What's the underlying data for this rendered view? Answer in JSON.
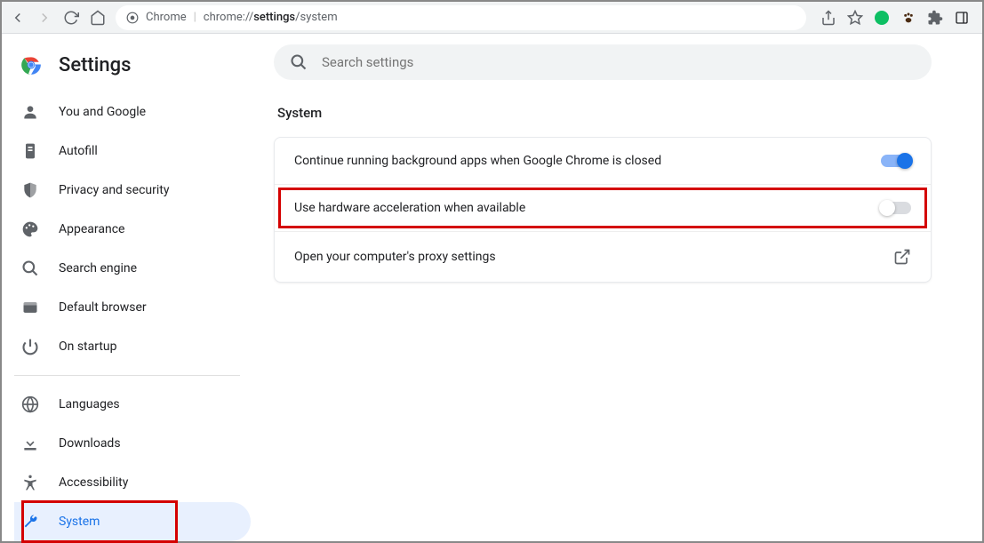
{
  "toolbar": {
    "url_prefix": "Chrome",
    "url_host": "chrome://",
    "url_path_bold": "settings",
    "url_path_rest": "/system"
  },
  "app": {
    "title": "Settings"
  },
  "sidebar": {
    "group1": [
      {
        "label": "You and Google",
        "icon": "person"
      },
      {
        "label": "Autofill",
        "icon": "autofill"
      },
      {
        "label": "Privacy and security",
        "icon": "shield"
      },
      {
        "label": "Appearance",
        "icon": "palette"
      },
      {
        "label": "Search engine",
        "icon": "search"
      },
      {
        "label": "Default browser",
        "icon": "browser"
      },
      {
        "label": "On startup",
        "icon": "power"
      }
    ],
    "group2": [
      {
        "label": "Languages",
        "icon": "globe"
      },
      {
        "label": "Downloads",
        "icon": "download"
      },
      {
        "label": "Accessibility",
        "icon": "accessibility"
      },
      {
        "label": "System",
        "icon": "wrench",
        "active": true
      }
    ]
  },
  "search": {
    "placeholder": "Search settings"
  },
  "section": {
    "title": "System"
  },
  "settings": {
    "bg_apps": {
      "label": "Continue running background apps when Google Chrome is closed",
      "on": true
    },
    "hw_accel": {
      "label": "Use hardware acceleration when available",
      "on": false
    },
    "proxy": {
      "label": "Open your computer's proxy settings"
    }
  },
  "colors": {
    "accent": "#1a73e8",
    "highlight": "#d40000"
  }
}
